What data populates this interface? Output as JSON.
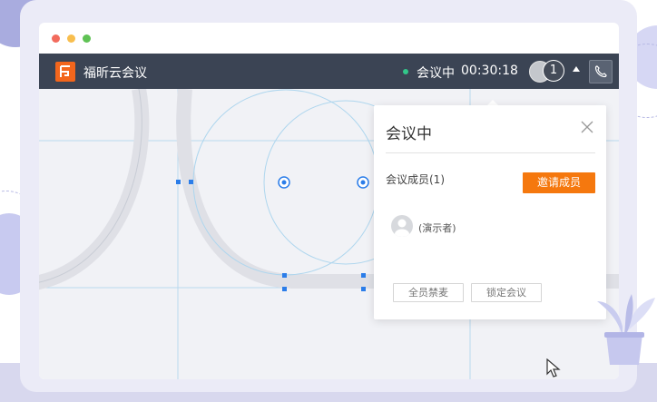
{
  "app": {
    "title": "福昕云会议",
    "icon": "foxit-logo-icon",
    "accent": "#f3661c",
    "titlebar_color": "#3b4454"
  },
  "window_controls": [
    "#f26b5d",
    "#f8be4e",
    "#5fc254"
  ],
  "meeting_status": {
    "label": "会议中",
    "timer": "00:30:18",
    "status_color": "#32c78a",
    "participant_count": "1"
  },
  "panel": {
    "title": "会议中",
    "members_label": "会议成员(1)",
    "invite_button": "邀请成员",
    "invite_color": "#f5780e",
    "members": [
      {
        "name": "(演示者)"
      }
    ],
    "mute_all_button": "全员禁麦",
    "lock_button": "锁定会议"
  }
}
